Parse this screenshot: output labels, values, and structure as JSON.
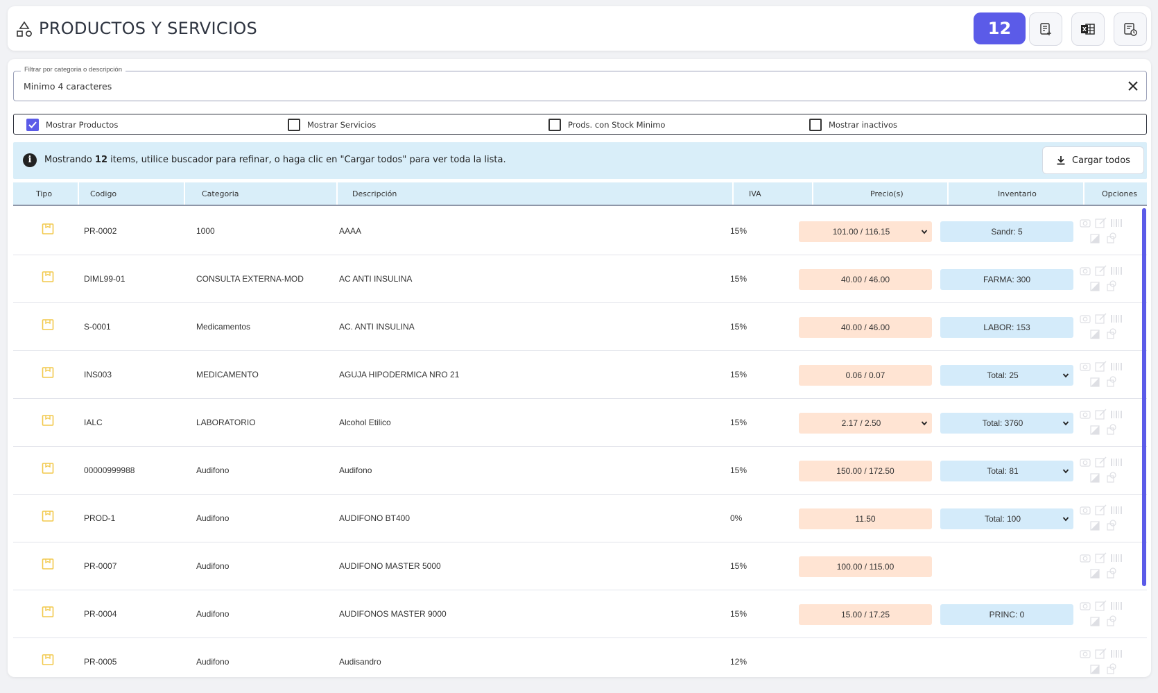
{
  "header": {
    "title": "PRODUCTOS Y SERVICIOS",
    "count": "12",
    "icons": [
      "shapes-icon",
      "new-document-icon",
      "excel-icon",
      "history-list-icon"
    ]
  },
  "filter": {
    "legend": "Filtrar por categoria o descripción",
    "placeholder": "Minimo 4 caracteres",
    "value": ""
  },
  "checks": {
    "productos": {
      "label": "Mostrar Productos",
      "checked": true
    },
    "servicios": {
      "label": "Mostrar Servicios",
      "checked": false
    },
    "stock": {
      "label": "Prods. con Stock Minimo",
      "checked": false
    },
    "inactivos": {
      "label": "Mostrar inactivos",
      "checked": false
    }
  },
  "info": {
    "prefix": "Mostrando ",
    "count": "12",
    "suffix": " items, utilice buscador para refinar, o haga clic en \"Cargar todos\" para ver toda la lista.",
    "button": "Cargar todos"
  },
  "columns": {
    "tipo": "Tipo",
    "codigo": "Codigo",
    "categoria": "Categoria",
    "descripcion": "Descripción",
    "iva": "IVA",
    "precios": "Precio(s)",
    "inventario": "Inventario",
    "opciones": "Opciones"
  },
  "rows": [
    {
      "codigo": "PR-0002",
      "categoria": "1000",
      "descripcion": "AAAA",
      "iva": "15%",
      "precio": "101.00 / 116.15",
      "precio_dd": true,
      "inventario": "Sandr: 5",
      "inv_dd": false
    },
    {
      "codigo": "DIML99-01",
      "categoria": "CONSULTA EXTERNA-MOD",
      "descripcion": "AC ANTI INSULINA",
      "iva": "15%",
      "precio": "40.00 / 46.00",
      "precio_dd": false,
      "inventario": "FARMA: 300",
      "inv_dd": false
    },
    {
      "codigo": "S-0001",
      "categoria": "Medicamentos",
      "descripcion": "AC. ANTI INSULINA",
      "iva": "15%",
      "precio": "40.00 / 46.00",
      "precio_dd": false,
      "inventario": "LABOR: 153",
      "inv_dd": false
    },
    {
      "codigo": "INS003",
      "categoria": "MEDICAMENTO",
      "descripcion": "AGUJA HIPODERMICA NRO 21",
      "iva": "15%",
      "precio": "0.06 / 0.07",
      "precio_dd": false,
      "inventario": "Total: 25",
      "inv_dd": true
    },
    {
      "codigo": "IALC",
      "categoria": "LABORATORIO",
      "descripcion": "Alcohol Etilico",
      "iva": "15%",
      "precio": "2.17 / 2.50",
      "precio_dd": true,
      "inventario": "Total: 3760",
      "inv_dd": true
    },
    {
      "codigo": "00000999988",
      "categoria": "Audifono",
      "descripcion": "Audifono",
      "iva": "15%",
      "precio": "150.00 / 172.50",
      "precio_dd": false,
      "inventario": "Total: 81",
      "inv_dd": true
    },
    {
      "codigo": "PROD-1",
      "categoria": "Audifono",
      "descripcion": "AUDIFONO BT400",
      "iva": "0%",
      "precio": "11.50",
      "precio_dd": false,
      "inventario": "Total: 100",
      "inv_dd": true
    },
    {
      "codigo": "PR-0007",
      "categoria": "Audifono",
      "descripcion": "AUDIFONO MASTER 5000",
      "iva": "15%",
      "precio": "100.00 / 115.00",
      "precio_dd": false,
      "inventario": "",
      "inv_dd": false
    },
    {
      "codigo": "PR-0004",
      "categoria": "Audifono",
      "descripcion": "AUDIFONOS MASTER 9000",
      "iva": "15%",
      "precio": "15.00 / 17.25",
      "precio_dd": false,
      "inventario": "PRINC: 0",
      "inv_dd": false
    },
    {
      "codigo": "PR-0005",
      "categoria": "Audifono",
      "descripcion": "Audisandro",
      "iva": "12%",
      "precio": "",
      "precio_dd": false,
      "inventario": "",
      "inv_dd": false
    }
  ],
  "colors": {
    "accent": "#5b5be8",
    "info_bg": "#d9eef9",
    "price_bg": "#ffe4d3",
    "inventory_bg": "#d4ebfa",
    "type_icon": "#f2c94c"
  }
}
